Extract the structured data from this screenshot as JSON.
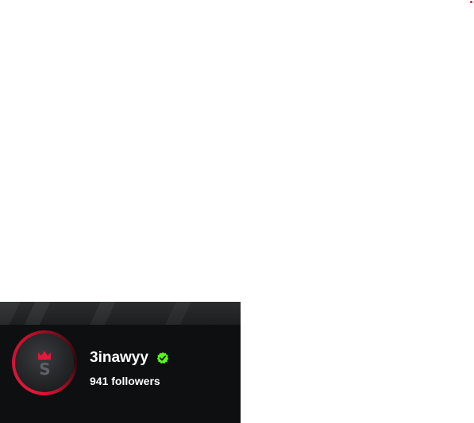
{
  "channel": {
    "name": "3inawyy",
    "followers_text": "941 followers",
    "verified_icon": "verified-badge-icon",
    "avatar_icon": "channel-avatar",
    "avatar_logo_text": "S"
  },
  "colors": {
    "card_background": "#0d0f10",
    "accent_red": "#e3183a",
    "verified_green": "#53fc18",
    "text": "#ffffff"
  }
}
